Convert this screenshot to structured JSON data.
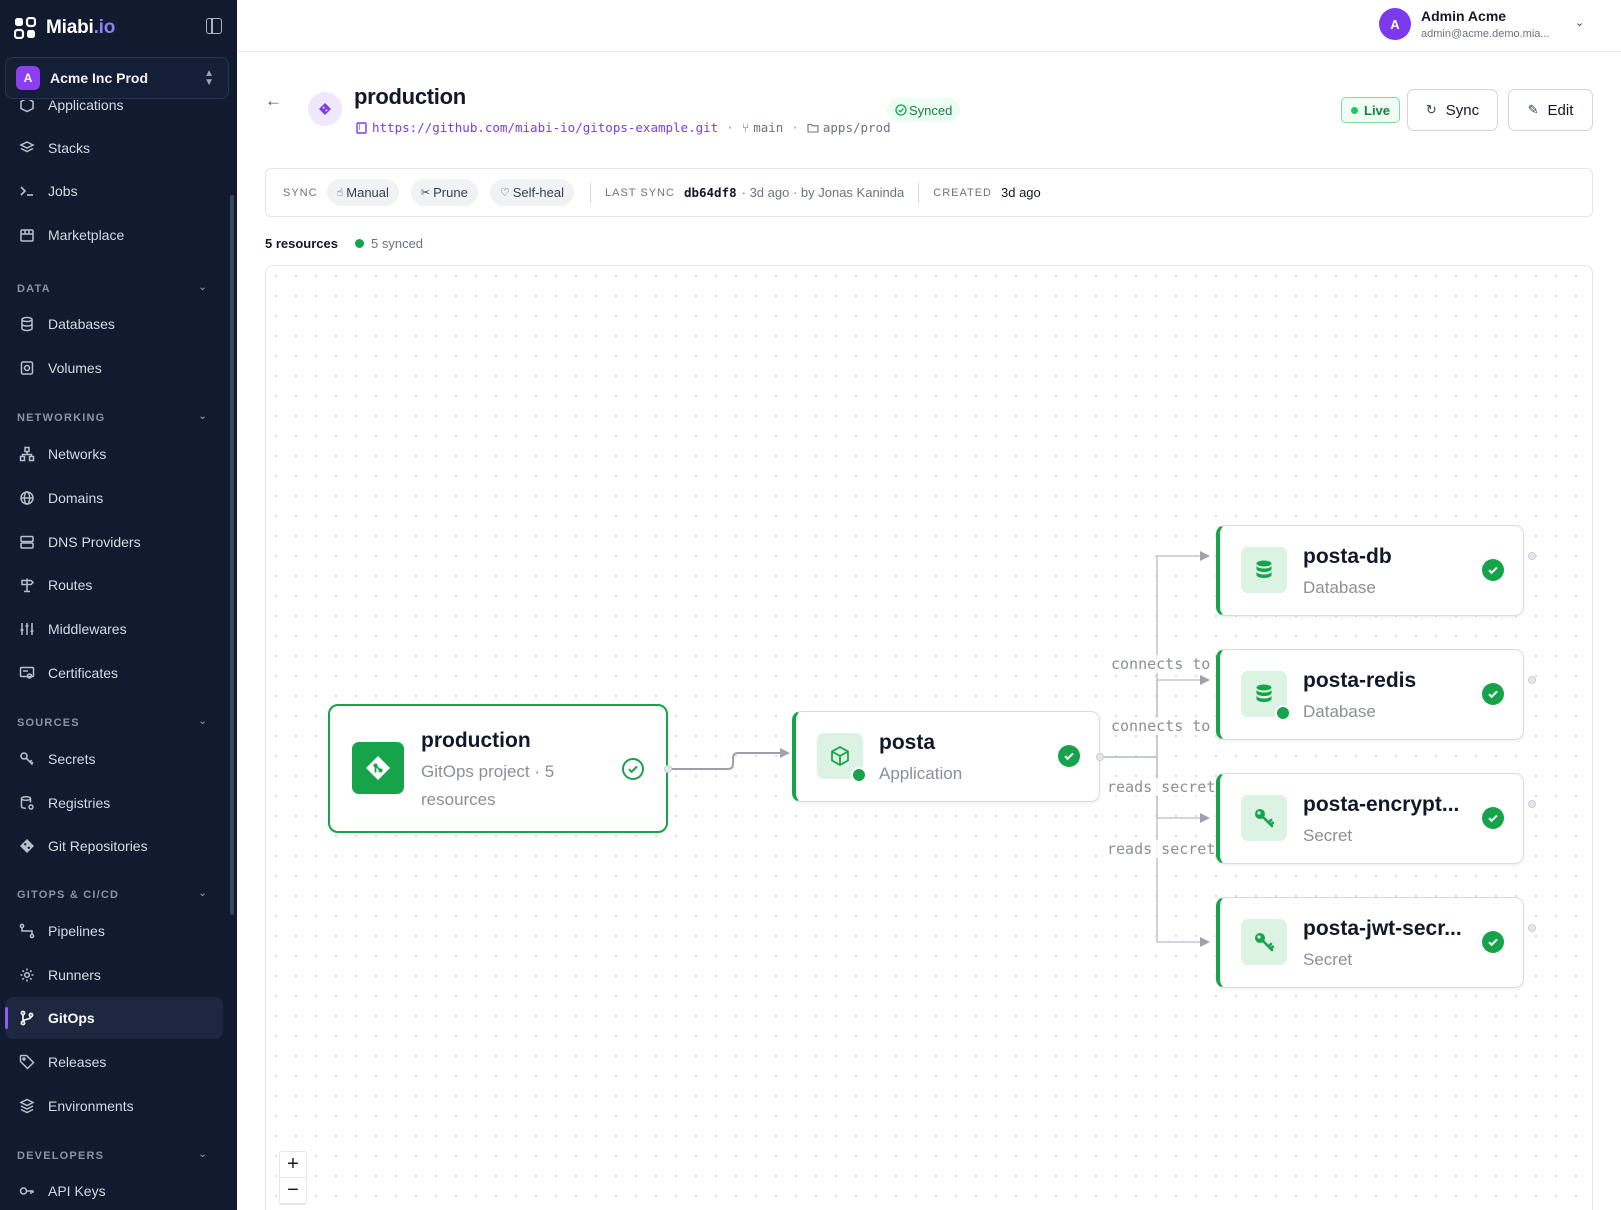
{
  "brand": {
    "name": "Miabi",
    "tld": ".io"
  },
  "org": {
    "initial": "A",
    "name": "Acme Inc Prod"
  },
  "sidebar": {
    "items": [
      {
        "label": "Applications",
        "icon": "cube-icon"
      },
      {
        "label": "Stacks",
        "icon": "layers-icon"
      },
      {
        "label": "Jobs",
        "icon": "terminal-icon"
      },
      {
        "label": "Marketplace",
        "icon": "store-icon"
      },
      {
        "label": "Databases",
        "icon": "database-icon"
      },
      {
        "label": "Volumes",
        "icon": "disk-icon"
      },
      {
        "label": "Networks",
        "icon": "network-icon"
      },
      {
        "label": "Domains",
        "icon": "globe-icon"
      },
      {
        "label": "DNS Providers",
        "icon": "server-icon"
      },
      {
        "label": "Routes",
        "icon": "signpost-icon"
      },
      {
        "label": "Middlewares",
        "icon": "sliders-icon"
      },
      {
        "label": "Certificates",
        "icon": "certificate-icon"
      },
      {
        "label": "Secrets",
        "icon": "key-icon"
      },
      {
        "label": "Registries",
        "icon": "registry-icon"
      },
      {
        "label": "Git Repositories",
        "icon": "git-icon"
      },
      {
        "label": "Pipelines",
        "icon": "pipeline-icon"
      },
      {
        "label": "Runners",
        "icon": "cog-icon"
      },
      {
        "label": "GitOps",
        "icon": "git-branch-icon",
        "active": true
      },
      {
        "label": "Releases",
        "icon": "tag-icon"
      },
      {
        "label": "Environments",
        "icon": "layers-icon"
      },
      {
        "label": "API Keys",
        "icon": "key-icon"
      }
    ],
    "sections": [
      "DATA",
      "NETWORKING",
      "SOURCES",
      "GITOPS & CI/CD",
      "DEVELOPERS"
    ]
  },
  "user": {
    "initial": "A",
    "name": "Admin Acme",
    "email": "admin@acme.demo.mia..."
  },
  "header": {
    "title": "production",
    "repo_url": "https://github.com/miabi-io/gitops-example.git",
    "branch": "main",
    "path": "apps/prod",
    "status": "Synced",
    "live_label": "Live",
    "sync_label": "Sync",
    "edit_label": "Edit"
  },
  "sync_bar": {
    "sync_label": "SYNC",
    "chips": [
      "Manual",
      "Prune",
      "Self-heal"
    ],
    "last_sync_label": "LAST SYNC",
    "commit": "db64df8",
    "last_sync_meta": "· 3d ago · by Jonas Kaninda",
    "created_label": "CREATED",
    "created_value": "3d ago"
  },
  "summary": {
    "resources": "5 resources",
    "synced": "5 synced"
  },
  "graph": {
    "root": {
      "title": "production",
      "subtitle": "GitOps project · 5 resources"
    },
    "app": {
      "title": "posta",
      "subtitle": "Application"
    },
    "children": [
      {
        "title": "posta-db",
        "subtitle": "Database",
        "edge": "connects to"
      },
      {
        "title": "posta-redis",
        "subtitle": "Database",
        "edge": "connects to"
      },
      {
        "title": "posta-encrypt...",
        "subtitle": "Secret",
        "edge": "reads secret"
      },
      {
        "title": "posta-jwt-secr...",
        "subtitle": "Secret",
        "edge": "reads secret"
      }
    ]
  },
  "zoom": {
    "in": "+",
    "out": "−"
  },
  "colors": {
    "accent": "#7c3aed",
    "success": "#16a34a",
    "sidebar_bg": "#111a2e"
  }
}
